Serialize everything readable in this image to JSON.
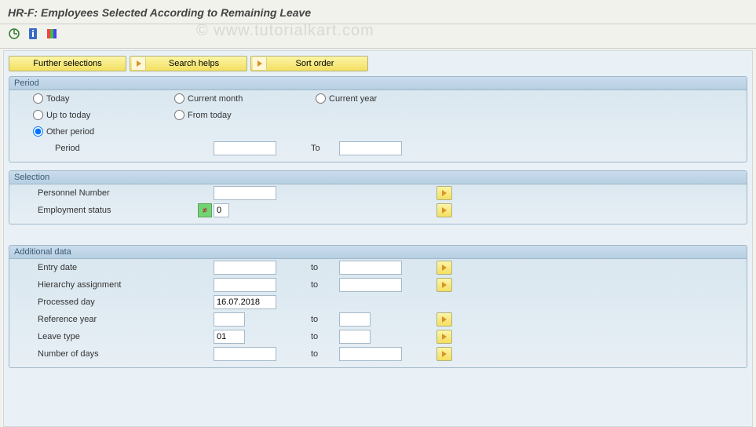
{
  "header": {
    "title": "HR-F: Employees Selected According to Remaining Leave"
  },
  "watermark": "© www.tutorialkart.com",
  "buttons": {
    "further_selections": "Further selections",
    "search_helps": "Search helps",
    "sort_order": "Sort order"
  },
  "period": {
    "title": "Period",
    "options": {
      "today": "Today",
      "current_month": "Current month",
      "current_year": "Current year",
      "up_to_today": "Up to today",
      "from_today": "From today",
      "other_period": "Other period"
    },
    "selected": "other_period",
    "period_label": "Period",
    "period_from": "",
    "to_label": "To",
    "period_to": ""
  },
  "selection": {
    "title": "Selection",
    "personnel_number_label": "Personnel Number",
    "personnel_number_value": "",
    "employment_status_label": "Employment status",
    "employment_status_value": "0"
  },
  "additional": {
    "title": "Additional data",
    "to_label": "to",
    "rows": {
      "entry_date": {
        "label": "Entry date",
        "from": "",
        "to": ""
      },
      "hierarchy": {
        "label": "Hierarchy assignment",
        "from": "",
        "to": ""
      },
      "processed_day": {
        "label": "Processed day",
        "value": "16.07.2018"
      },
      "reference_year": {
        "label": "Reference year",
        "from": "",
        "to": ""
      },
      "leave_type": {
        "label": "Leave type",
        "from": "01",
        "to": ""
      },
      "number_of_days": {
        "label": "Number of days",
        "from": "",
        "to": ""
      }
    }
  }
}
